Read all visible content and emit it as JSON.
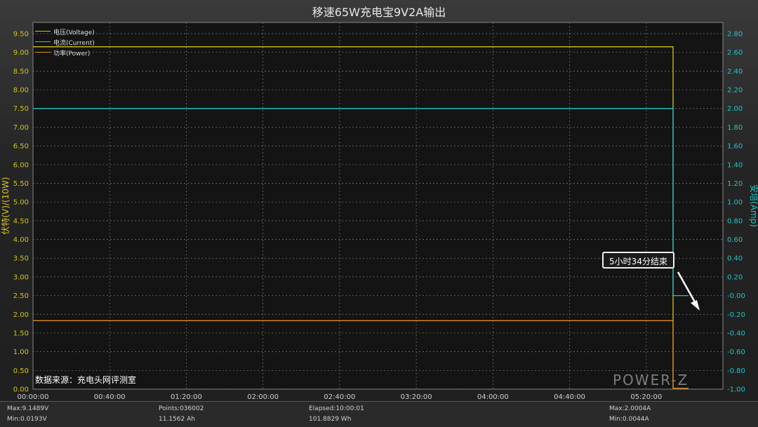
{
  "title": "移速65W充电宝9V2A输出",
  "colors": {
    "voltage": "#d4c21a",
    "current": "#22c4c4",
    "power": "#e08a1e",
    "grid": "#7a7a7a",
    "left_axis": "#d4c21a",
    "right_axis": "#22c4c4"
  },
  "legend": [
    {
      "label": "电压(Voltage)",
      "color": "#d4c21a"
    },
    {
      "label": "电流(Current)",
      "color": "#22c4c4"
    },
    {
      "label": "功率(Power)",
      "color": "#e08a1e"
    }
  ],
  "source_note": "数据来源：充电头网评测室",
  "annotation": "5小时34分结束",
  "watermark": "POWER-Z",
  "stats": {
    "max_v": "Max:9.1489V",
    "min_v": "Min:0.0193V",
    "points": "Points:036002",
    "ah": "11.1562 Ah",
    "elapsed": "Elapsed:10:00:01",
    "wh": "101.8829 Wh",
    "max_a": "Max:2.0004A",
    "min_a": "Min:0.0044A"
  },
  "chart_data": {
    "type": "line",
    "title": "移速65W充电宝9V2A输出",
    "xlabel": "",
    "ylabel_left": "伏特(V)/(10W)",
    "ylabel_right": "安培(Amp)",
    "x_ticks": [
      "00:00:00",
      "00:40:00",
      "01:20:00",
      "02:00:00",
      "02:40:00",
      "03:20:00",
      "04:00:00",
      "04:40:00",
      "05:20:00"
    ],
    "xlim_minutes": [
      0,
      360
    ],
    "y_left_ticks": [
      "0.00",
      "0.50",
      "1.00",
      "1.50",
      "2.00",
      "2.50",
      "3.00",
      "3.50",
      "4.00",
      "4.50",
      "5.00",
      "5.50",
      "6.00",
      "6.50",
      "7.00",
      "7.50",
      "8.00",
      "8.50",
      "9.00",
      "9.50"
    ],
    "ylim_left": [
      0,
      9.8
    ],
    "y_right_ticks": [
      "-1.00",
      "-0.80",
      "-0.60",
      "-0.40",
      "-0.20",
      "-0.00",
      "0.20",
      "0.40",
      "0.60",
      "0.80",
      "1.00",
      "1.20",
      "1.40",
      "1.60",
      "1.80",
      "2.00",
      "2.20",
      "2.40",
      "2.60",
      "2.80"
    ],
    "ylim_right": [
      -1.0,
      2.92
    ],
    "grid": true,
    "legend_position": "top-left",
    "series": [
      {
        "name": "电压(Voltage)",
        "axis": "left",
        "x_minutes": [
          0,
          334,
          334,
          342
        ],
        "values": [
          9.149,
          9.149,
          0.02,
          0.02
        ]
      },
      {
        "name": "电流(Current)",
        "axis": "right",
        "x_minutes": [
          0,
          334,
          334,
          342
        ],
        "values": [
          2.0,
          2.0,
          0.0,
          0.0
        ]
      },
      {
        "name": "功率(Power)",
        "axis": "left",
        "x_minutes": [
          0,
          334,
          334,
          342
        ],
        "values": [
          1.83,
          1.83,
          0.02,
          0.02
        ]
      }
    ]
  }
}
